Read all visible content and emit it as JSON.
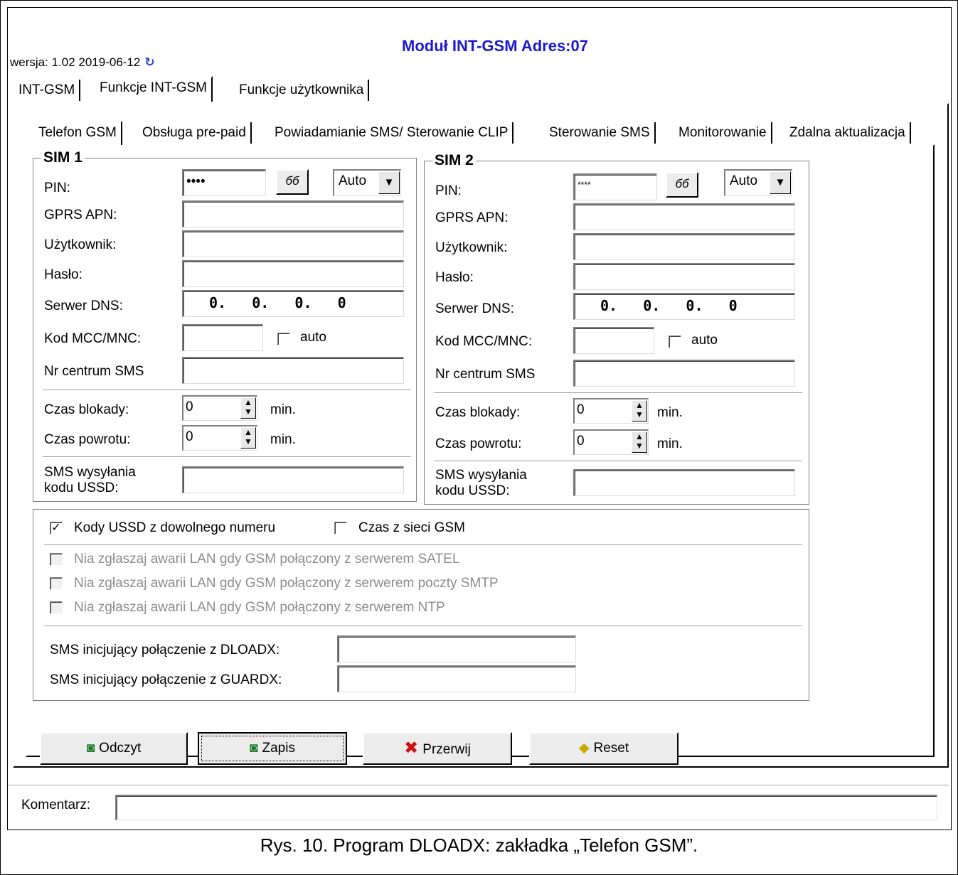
{
  "window": {
    "title": "Moduł INT-GSM Adres:07",
    "version": "wersja: 1.02 2019-06-12",
    "refresh_icon": "↻"
  },
  "main_tabs": [
    "INT-GSM",
    "Funkcje INT-GSM",
    "Funkcje użytkownika"
  ],
  "sub_tabs": [
    "Telefon GSM",
    "Obsługa pre-paid",
    "Powiadamianie SMS/ Sterowanie CLIP",
    "Sterowanie SMS",
    "Monitorowanie",
    "Zdalna aktualizacja"
  ],
  "sim1": {
    "title": "SIM 1",
    "pin_label": "PIN:",
    "pin_value": "••••",
    "show_button": "бб",
    "mode_value": "Auto",
    "apn_label": "GPRS APN:",
    "apn_value": "",
    "user_label": "Użytkownik:",
    "user_value": "",
    "pass_label": "Hasło:",
    "pass_value": "",
    "dns_label": "Serwer DNS:",
    "dns_value": "0.   0.   0.   0",
    "mcc_label": "Kod MCC/MNC:",
    "mcc_value": "",
    "auto_label": "auto",
    "sms_center_label": "Nr centrum SMS",
    "sms_center_value": "",
    "block_label": "Czas blokady:",
    "block_value": "0",
    "return_label": "Czas powrotu:",
    "return_value": "0",
    "min_label": "min.",
    "ussd_label_1": "SMS wysyłania",
    "ussd_label_2": "kodu USSD:",
    "ussd_value": ""
  },
  "sim2": {
    "title": "SIM 2",
    "pin_label": "PIN:",
    "pin_value": "****",
    "show_button": "бб",
    "mode_value": "Auto",
    "apn_label": "GPRS APN:",
    "apn_value": "",
    "user_label": "Użytkownik:",
    "user_value": "",
    "pass_label": "Hasło:",
    "pass_value": "",
    "dns_label": "Serwer DNS:",
    "dns_value": "0.   0.   0.   0",
    "mcc_label": "Kod MCC/MNC:",
    "mcc_value": "",
    "auto_label": "auto",
    "sms_center_label": "Nr centrum SMS",
    "sms_center_value": "",
    "block_label": "Czas blokady:",
    "block_value": "0",
    "return_label": "Czas powrotu:",
    "return_value": "0",
    "min_label": "min.",
    "ussd_label_1": "SMS wysyłania",
    "ussd_label_2": "kodu USSD:",
    "ussd_value": ""
  },
  "options": {
    "ussd_any_label": "Kody USSD z dowolnego numeru",
    "ussd_any_checked": true,
    "time_gsm_label": "Czas z sieci GSM",
    "time_gsm_checked": false,
    "no_lan_satel": "Nia zgłaszaj awarii LAN gdy GSM połączony z serwerem SATEL",
    "no_lan_smtp": "Nia zgłaszaj awarii LAN gdy GSM połączony z serwerem poczty SMTP",
    "no_lan_ntp": "Nia zgłaszaj awarii LAN gdy GSM połączony z serwerem NTP",
    "dloadx_label": "SMS inicjujący połączenie z DLOADX:",
    "dloadx_value": "",
    "guardx_label": "SMS inicjujący połączenie z GUARDX:",
    "guardx_value": ""
  },
  "buttons": {
    "read": "Odczyt",
    "write": "Zapis",
    "abort": "Przerwij",
    "reset": "Reset"
  },
  "comment": {
    "label": "Komentarz:",
    "value": ""
  },
  "caption": "Rys. 10. Program DLOADX: zakładka „Telefon GSM”."
}
